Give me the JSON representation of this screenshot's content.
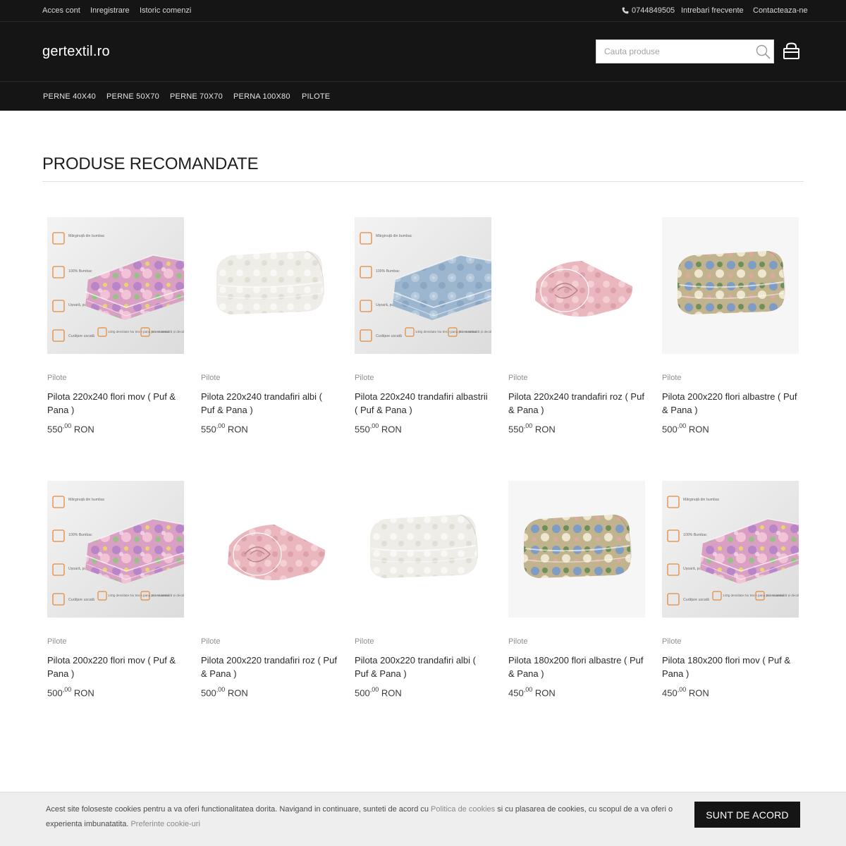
{
  "topbar": {
    "links": [
      "Acces cont",
      "Inregistrare",
      "Istoric comenzi"
    ],
    "phone": "0744849505",
    "faq": "Intrebari frecvente",
    "contact": "Contacteaza-ne"
  },
  "header": {
    "logo": "gertextil.ro",
    "search_placeholder": "Cauta produse"
  },
  "nav": [
    "PERNE 40X40",
    "PERNE 50X70",
    "PERNE 70X70",
    "PERNA 100X80",
    "PILOTE"
  ],
  "section": {
    "title": "PRODUSE RECOMANDATE"
  },
  "products": [
    {
      "category": "Pilote",
      "name": "Pilota 220x240 flori mov ( Puf & Pana )",
      "price_int": "550",
      "price_dec": ",00",
      "currency": "RON",
      "image": "floral-mauve-infographic"
    },
    {
      "category": "Pilote",
      "name": "Pilota 220x240 trandafiri albi ( Puf & Pana )",
      "price_int": "550",
      "price_dec": ",00",
      "currency": "RON",
      "image": "white-roses-folded"
    },
    {
      "category": "Pilote",
      "name": "Pilota 220x240 trandafiri albastrii ( Puf & Pana )",
      "price_int": "550",
      "price_dec": ",00",
      "currency": "RON",
      "image": "blue-roses-infographic"
    },
    {
      "category": "Pilote",
      "name": "Pilota 220x240 trandafiri roz ( Puf & Pana )",
      "price_int": "550",
      "price_dec": ",00",
      "currency": "RON",
      "image": "pink-roses-rolled"
    },
    {
      "category": "Pilote",
      "name": "Pilota 200x220 flori albastre ( Puf & Pana )",
      "price_int": "500",
      "price_dec": ",00",
      "currency": "RON",
      "image": "beige-floral-folded"
    },
    {
      "category": "Pilote",
      "name": "Pilota 200x220 flori mov ( Puf & Pana )",
      "price_int": "500",
      "price_dec": ",00",
      "currency": "RON",
      "image": "floral-mauve-infographic"
    },
    {
      "category": "Pilote",
      "name": "Pilota 200x220 trandafiri roz ( Puf & Pana )",
      "price_int": "500",
      "price_dec": ",00",
      "currency": "RON",
      "image": "pink-roses-rolled"
    },
    {
      "category": "Pilote",
      "name": "Pilota 200x220 trandafiri albi ( Puf & Pana )",
      "price_int": "500",
      "price_dec": ",00",
      "currency": "RON",
      "image": "white-roses-folded"
    },
    {
      "category": "Pilote",
      "name": "Pilota 180x200 flori albastre ( Puf & Pana )",
      "price_int": "450",
      "price_dec": ",00",
      "currency": "RON",
      "image": "beige-floral-folded"
    },
    {
      "category": "Pilote",
      "name": "Pilota 180x200 flori mov ( Puf & Pana )",
      "price_int": "450",
      "price_dec": ",00",
      "currency": "RON",
      "image": "floral-mauve-infographic"
    }
  ],
  "infographic": {
    "labels": [
      "Mărginuță din bumbac",
      "100% Bumbac",
      "Ușoară, pufoasă și călduroasă",
      "Curățare uscată",
      "140g densitate Nu trece pana prin material",
      "Nu se tasează și decolorează în timp"
    ]
  },
  "cookie": {
    "text_before": "Acest site foloseste cookies pentru a va oferi functionalitatea dorita. Navigand in continuare, sunteti de acord cu ",
    "policy_link": "Politica de cookies",
    "text_after": " si cu plasarea de cookies, cu scopul de a va oferi o experienta imbunatatita. ",
    "prefs_link": "Preferinte cookie-uri",
    "accept": "SUNT DE ACORD"
  },
  "colors": {
    "dark": "#151515",
    "mauve": "#d9a0c3",
    "blue": "#9db6cf",
    "pink": "#e9b7bf",
    "white_quilt": "#eeece6",
    "beige": "#b8a784"
  }
}
